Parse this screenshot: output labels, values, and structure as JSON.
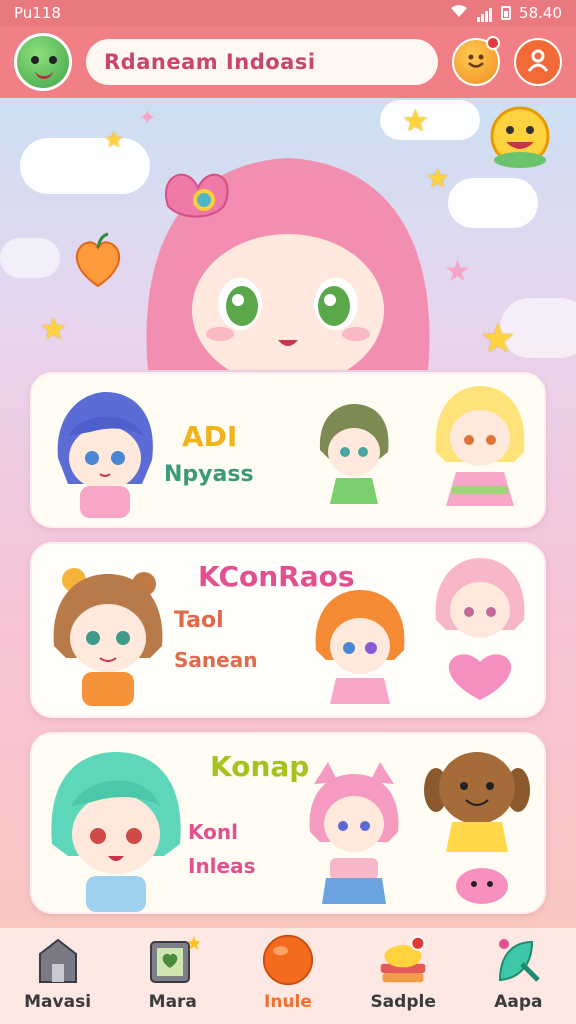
{
  "status_bar": {
    "left": "Pu118",
    "time": "58.40"
  },
  "header": {
    "search_value": "Rdaneam Indoasi"
  },
  "cards": [
    {
      "title": "ADI",
      "subtitle": "Npyass"
    },
    {
      "title": "KConRaos",
      "line1": "Taol",
      "line2": "Sanean"
    },
    {
      "title": "Konap",
      "line1": "Konl",
      "line2": "Inleas"
    }
  ],
  "nav": [
    {
      "label": "Mavasi",
      "icon": "house-icon"
    },
    {
      "label": "Mara",
      "icon": "picture-frame-icon"
    },
    {
      "label": "Inule",
      "icon": "orange-ball-icon",
      "active": true
    },
    {
      "label": "Sadple",
      "icon": "book-stack-icon"
    },
    {
      "label": "Aapa",
      "icon": "app-leaf-icon"
    }
  ],
  "colors": {
    "accent": "#f0702e",
    "header": "#f07f86",
    "status": "#e9787f",
    "search_text": "#c9456d"
  }
}
